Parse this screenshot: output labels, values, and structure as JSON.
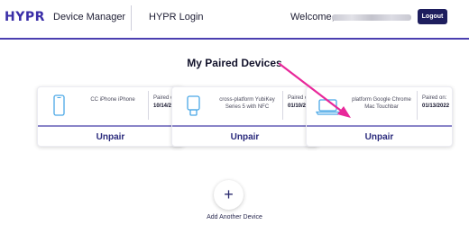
{
  "header": {
    "logo": "HYPR",
    "app_name": "Device Manager",
    "nav_link": "HYPR Login",
    "welcome": "Welcome,",
    "logout_label": "Logout"
  },
  "main": {
    "title": "My Paired Devices",
    "devices": [
      {
        "icon": "phone-icon",
        "name": "CC iPhone iPhone",
        "paired_label": "Paired on:",
        "paired_date": "10/14/2021",
        "action": "Unpair"
      },
      {
        "icon": "security-key-icon",
        "name": "cross-platform YubiKey Series 5 with NFC",
        "paired_label": "Paired on:",
        "paired_date": "01/10/2022",
        "action": "Unpair"
      },
      {
        "icon": "laptop-icon",
        "name": "platform Google Chrome Mac Touchbar",
        "paired_label": "Paired on:",
        "paired_date": "01/13/2022",
        "action": "Unpair"
      }
    ],
    "add_label": "Add Another Device",
    "add_symbol": "+"
  },
  "colors": {
    "brand": "#3a2ea8",
    "logout_bg": "#1e1e5e",
    "annotation_arrow": "#e8289a"
  }
}
